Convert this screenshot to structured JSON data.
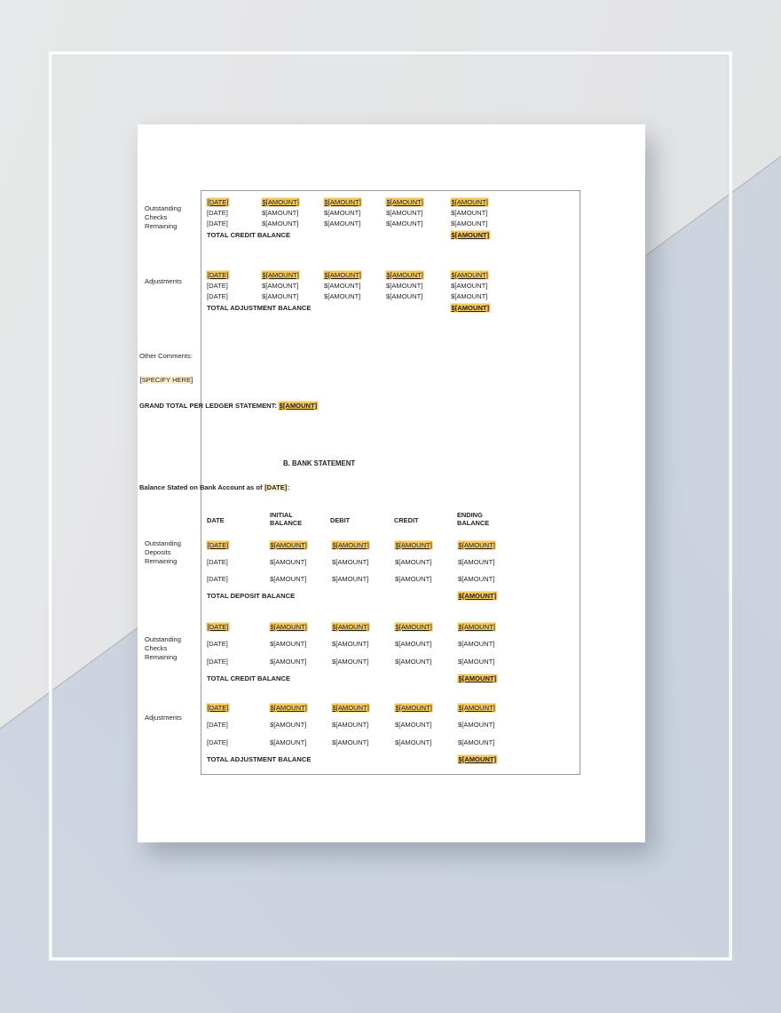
{
  "document": {
    "type": "bank-reconciliation-template",
    "placeholders": {
      "date": "[DATE]",
      "amount": "$[AMOUNT]",
      "specify": "[SPECIFY HERE]"
    },
    "colors": {
      "highlight_gold": "#f2c75c",
      "highlight_cream": "#fdf0cc",
      "page": "#ffffff",
      "bg_gray": "#e9eaeb",
      "bg_blue": "#ccd5e0",
      "text": "#231f20",
      "table_border": "#9a9a9a"
    },
    "ledger_section": {
      "blocks": [
        {
          "label": "Outstanding\nChecks\nRemaining",
          "label_lines": [
            "Outstanding",
            "Checks",
            "Remaining"
          ],
          "rows": [
            {
              "date": "[DATE]",
              "c1": "$[AMOUNT]",
              "c2": "$[AMOUNT]",
              "c3": "$[AMOUNT]",
              "c4": "$[AMOUNT]",
              "highlight": true
            },
            {
              "date": "[DATE]",
              "c1": "$[AMOUNT]",
              "c2": "$[AMOUNT]",
              "c3": "$[AMOUNT]",
              "c4": "$[AMOUNT]",
              "highlight": false
            },
            {
              "date": "[DATE]",
              "c1": "$[AMOUNT]",
              "c2": "$[AMOUNT]",
              "c3": "$[AMOUNT]",
              "c4": "$[AMOUNT]",
              "highlight": false
            }
          ],
          "total_label": "TOTAL CREDIT BALANCE",
          "total_value": "$[AMOUNT]"
        },
        {
          "label": "Adjustments",
          "label_lines": [
            "Adjustments"
          ],
          "rows": [
            {
              "date": "[DATE]",
              "c1": "$[AMOUNT]",
              "c2": "$[AMOUNT]",
              "c3": "$[AMOUNT]",
              "c4": "$[AMOUNT]",
              "highlight": true
            },
            {
              "date": "[DATE]",
              "c1": "$[AMOUNT]",
              "c2": "$[AMOUNT]",
              "c3": "$[AMOUNT]",
              "c4": "$[AMOUNT]",
              "highlight": false
            },
            {
              "date": "[DATE]",
              "c1": "$[AMOUNT]",
              "c2": "$[AMOUNT]",
              "c3": "$[AMOUNT]",
              "c4": "$[AMOUNT]",
              "highlight": false
            }
          ],
          "total_label": "TOTAL ADJUSTMENT BALANCE",
          "total_value": "$[AMOUNT]"
        }
      ]
    },
    "comments": {
      "heading": "Other Comments:",
      "value": "[SPECIFY HERE]"
    },
    "grand_total": {
      "label": "GRAND TOTAL PER LEDGER STATEMENT:",
      "value": "$[AMOUNT]"
    },
    "bank_section": {
      "title": "B. BANK STATEMENT",
      "balance_line_prefix": "Balance Stated on Bank Account as of ",
      "balance_line_date": "[DATE]",
      "balance_line_suffix": ":",
      "columns": [
        "DATE",
        "INITIAL\nBALANCE",
        "DEBIT",
        "CREDIT",
        "ENDING\nBALANCE"
      ],
      "column_labels": {
        "date": "DATE",
        "initial_balance": "INITIAL\nBALANCE",
        "debit": "DEBIT",
        "credit": "CREDIT",
        "ending_balance": "ENDING\nBALANCE"
      },
      "blocks": [
        {
          "label_lines": [
            "Outstanding",
            "Deposits",
            "Remaining"
          ],
          "rows": [
            {
              "date": "[DATE]",
              "c1": "$[AMOUNT]",
              "c2": "$[AMOUNT]",
              "c3": "$[AMOUNT]",
              "c4": "$[AMOUNT]",
              "highlight": true
            },
            {
              "date": "[DATE]",
              "c1": "$[AMOUNT]",
              "c2": "$[AMOUNT]",
              "c3": "$[AMOUNT]",
              "c4": "$[AMOUNT]",
              "highlight": false
            },
            {
              "date": "[DATE]",
              "c1": "$[AMOUNT]",
              "c2": "$[AMOUNT]",
              "c3": "$[AMOUNT]",
              "c4": "$[AMOUNT]",
              "highlight": false
            }
          ],
          "total_label": "TOTAL DEPOSIT BALANCE",
          "total_value": "$[AMOUNT]"
        },
        {
          "label_lines": [
            "Outstanding",
            "Checks",
            "Remaining"
          ],
          "rows": [
            {
              "date": "[DATE]",
              "c1": "$[AMOUNT]",
              "c2": "$[AMOUNT]",
              "c3": "$[AMOUNT]",
              "c4": "$[AMOUNT]",
              "highlight": true
            },
            {
              "date": "[DATE]",
              "c1": "$[AMOUNT]",
              "c2": "$[AMOUNT]",
              "c3": "$[AMOUNT]",
              "c4": "$[AMOUNT]",
              "highlight": false
            },
            {
              "date": "[DATE]",
              "c1": "$[AMOUNT]",
              "c2": "$[AMOUNT]",
              "c3": "$[AMOUNT]",
              "c4": "$[AMOUNT]",
              "highlight": false
            }
          ],
          "total_label": "TOTAL CREDIT BALANCE",
          "total_value": "$[AMOUNT]"
        },
        {
          "label_lines": [
            "Adjustments"
          ],
          "rows": [
            {
              "date": "[DATE]",
              "c1": "$[AMOUNT]",
              "c2": "$[AMOUNT]",
              "c3": "$[AMOUNT]",
              "c4": "$[AMOUNT]",
              "highlight": true
            },
            {
              "date": "[DATE]",
              "c1": "$[AMOUNT]",
              "c2": "$[AMOUNT]",
              "c3": "$[AMOUNT]",
              "c4": "$[AMOUNT]",
              "highlight": false
            },
            {
              "date": "[DATE]",
              "c1": "$[AMOUNT]",
              "c2": "$[AMOUNT]",
              "c3": "$[AMOUNT]",
              "c4": "$[AMOUNT]",
              "highlight": false
            }
          ],
          "total_label": "TOTAL ADJUSTMENT BALANCE",
          "total_value": "$[AMOUNT]"
        }
      ]
    }
  }
}
